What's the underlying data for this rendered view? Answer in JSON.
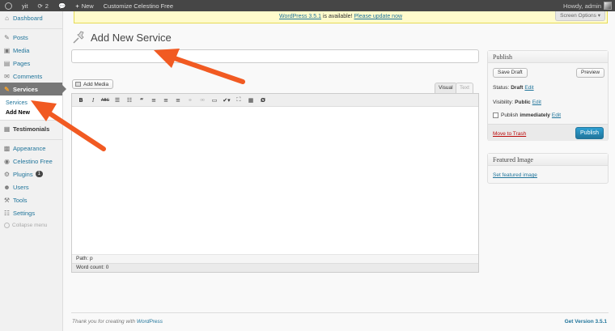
{
  "admin_bar": {
    "site_name": "yit",
    "updates_count": "2",
    "new_label": "New",
    "customize_label": "Customize Celestino Free",
    "howdy": "Howdy, admin"
  },
  "sidebar": {
    "items": [
      {
        "label": "Dashboard",
        "icon": "dashboard-icon"
      },
      {
        "label": "Posts",
        "icon": "pin-icon"
      },
      {
        "label": "Media",
        "icon": "media-icon"
      },
      {
        "label": "Pages",
        "icon": "page-icon"
      },
      {
        "label": "Comments",
        "icon": "comment-icon"
      },
      {
        "label": "Services",
        "icon": "services-icon"
      },
      {
        "label": "Testimonials",
        "icon": "testimonials-icon"
      },
      {
        "label": "Appearance",
        "icon": "appearance-icon"
      },
      {
        "label": "Celestino Free",
        "icon": "theme-icon"
      },
      {
        "label": "Plugins",
        "icon": "plugin-icon",
        "badge": "1"
      },
      {
        "label": "Users",
        "icon": "users-icon"
      },
      {
        "label": "Tools",
        "icon": "tools-icon"
      },
      {
        "label": "Settings",
        "icon": "settings-icon"
      }
    ],
    "submenu": [
      "Services",
      "Add New"
    ],
    "collapse_label": "Collapse menu"
  },
  "notice": {
    "text": "WordPress 3.5.1",
    "middle": " is available! ",
    "link": "Please update now"
  },
  "screen_options": "Screen Options",
  "page": {
    "title": "Add New Service",
    "title_input_value": ""
  },
  "editor": {
    "add_media": "Add Media",
    "tab_visual": "Visual",
    "tab_text": "Text",
    "path": "Path: p",
    "word_count": "Word count: 0"
  },
  "publish": {
    "heading": "Publish",
    "save_draft": "Save Draft",
    "preview": "Preview",
    "status_label": "Status:",
    "status_value": "Draft",
    "visibility_label": "Visibility:",
    "visibility_value": "Public",
    "publish_label": "Publish",
    "publish_value": "immediately",
    "edit": "Edit",
    "trash": "Move to Trash",
    "publish_button": "Publish"
  },
  "featured": {
    "heading": "Featured Image",
    "link": "Set featured image"
  },
  "footer": {
    "left": "Thank you for creating with ",
    "left_link": "WordPress",
    "right": "Get Version 3.5.1"
  },
  "colors": {
    "link": "#21759b",
    "arrow": "#f15a22",
    "admin_bar": "#464646"
  }
}
